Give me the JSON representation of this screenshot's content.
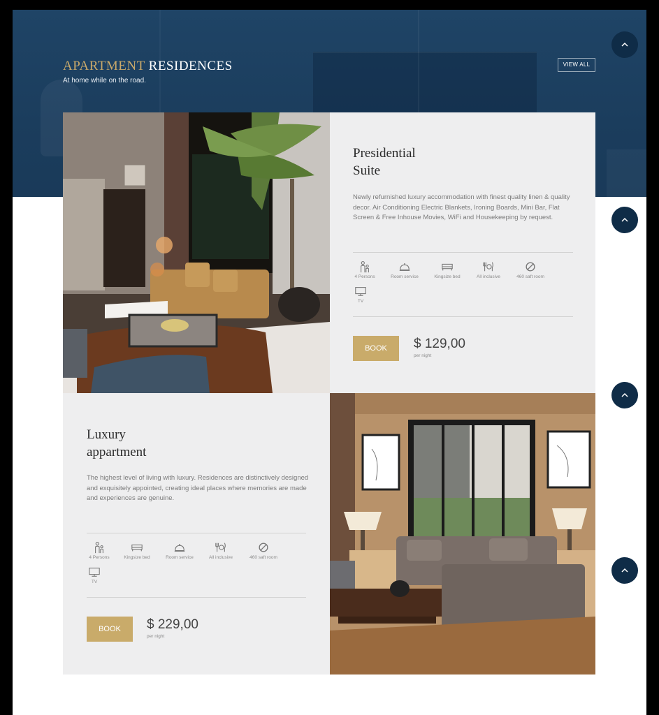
{
  "header": {
    "title_accent": "APARTMENT",
    "title_rest": " RESIDENCES",
    "subtitle": "At home while on the road.",
    "view_all": "VIEW ALL"
  },
  "rooms": [
    {
      "title_line1": "Presidential",
      "title_line2": "Suite",
      "description": "Newly refurnished luxury accommodation with finest quality linen & quality decor. Air Conditioning Electric Blankets, Ironing Boards, Mini Bar, Flat Screen & Free Inhouse Movies, WiFi and Housekeeping by request.",
      "amenities": [
        {
          "label": "4 Persons",
          "icon": "persons-icon"
        },
        {
          "label": "Room service",
          "icon": "room-service-icon"
        },
        {
          "label": "Kingsize bed",
          "icon": "bed-icon"
        },
        {
          "label": "All inclusive",
          "icon": "cutlery-icon"
        },
        {
          "label": "460 saft room",
          "icon": "no-smoking-icon"
        },
        {
          "label": "TV",
          "icon": "tv-icon"
        }
      ],
      "book_label": "BOOK",
      "price": "$ 129,00",
      "per_night": "per night"
    },
    {
      "title_line1": "Luxury",
      "title_line2": "appartment",
      "description": "The highest level of living with luxury. Residences are distinctively designed and exquisitely appointed, creating ideal places where memories are made and experiences are genuine.",
      "amenities": [
        {
          "label": "4 Persons",
          "icon": "persons-icon"
        },
        {
          "label": "Kingsize bed",
          "icon": "bed-icon"
        },
        {
          "label": "Room service",
          "icon": "room-service-icon"
        },
        {
          "label": "All inclusive",
          "icon": "cutlery-icon"
        },
        {
          "label": "460 saft room",
          "icon": "no-smoking-icon"
        },
        {
          "label": "TV",
          "icon": "tv-icon"
        }
      ],
      "book_label": "BOOK",
      "price": "$ 229,00",
      "per_night": "per night"
    }
  ],
  "colors": {
    "navy": "#1b3d5d",
    "gold": "#c9ab6a",
    "card_bg": "#eeeeef",
    "button_dark": "#0f2c47"
  }
}
